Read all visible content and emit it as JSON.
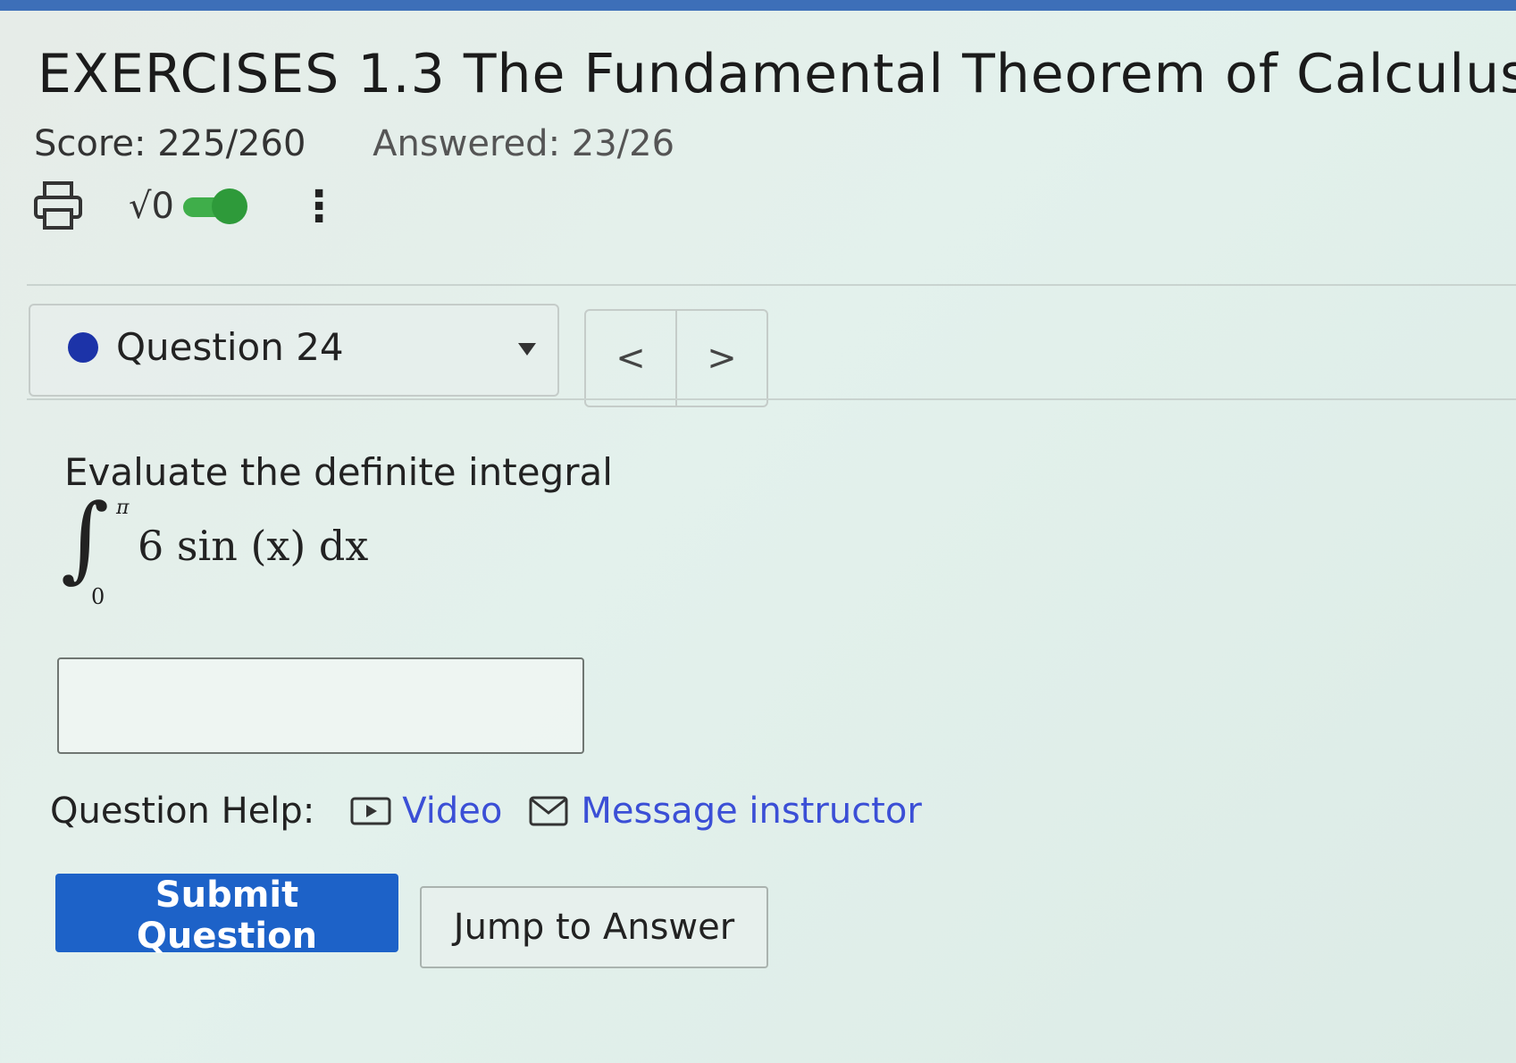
{
  "header": {
    "title": "EXERCISES 1.3 The Fundamental Theorem of Calculus",
    "score": "Score: 225/260",
    "answered": "Answered: 23/26"
  },
  "toolbar": {
    "print_icon": "printer-icon",
    "math_icon_label": "√0",
    "math_toggle_on": true,
    "menu_icon": "⋮"
  },
  "question_nav": {
    "current_label": "Question 24",
    "status_color": "#1c33a8",
    "prev_label": "<",
    "next_label": ">"
  },
  "question": {
    "prompt": "Evaluate the definite integral",
    "integral": {
      "sign": "∫",
      "upper": "π",
      "lower": "0",
      "integrand": "6 sin (x) dx"
    },
    "answer_value": ""
  },
  "help": {
    "label": "Question Help:",
    "video_label": "Video",
    "message_label": "Message instructor",
    "link_color": "#3b4fd6"
  },
  "actions": {
    "submit_label": "Submit Question",
    "jump_label": "Jump to Answer",
    "primary_color": "#1d62c8"
  }
}
